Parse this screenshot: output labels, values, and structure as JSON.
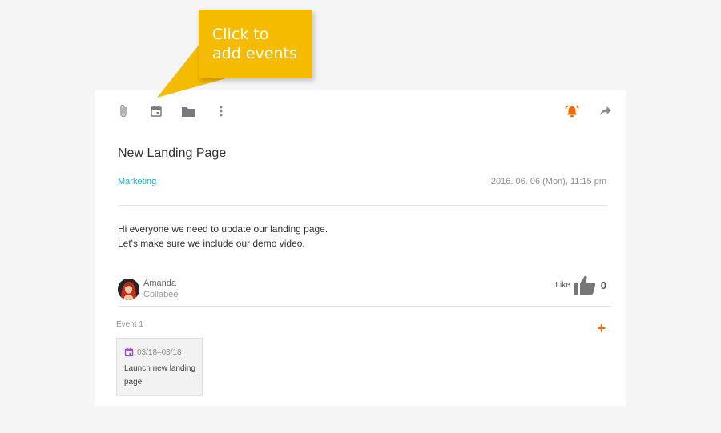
{
  "callout": {
    "text": "Click to\nadd events",
    "color": "#f5bb00"
  },
  "toolbar": {
    "left_icons": [
      "paperclip-icon",
      "calendar-icon",
      "folder-icon",
      "more-vertical-icon"
    ],
    "right_icons": [
      "alarm-bell-icon",
      "share-forward-icon"
    ],
    "accent_color": "#ef6a00"
  },
  "post": {
    "title": "New Landing Page",
    "category": "Marketing",
    "category_color": "#1fb2b2",
    "timestamp": "2016. 06. 06 (Mon), 11:15 pm",
    "body_lines": [
      "Hi everyone we need to update our landing page.",
      "Let's make sure we include our demo video."
    ]
  },
  "author": {
    "name": "Amanda",
    "org": "Collabee"
  },
  "like": {
    "label": "Like",
    "count": "0"
  },
  "events": {
    "label": "Event 1",
    "add_symbol": "+",
    "items": [
      {
        "date": "03/18–03/18",
        "title": "Launch new landing page",
        "icon_color": "#a24ac8"
      }
    ]
  }
}
